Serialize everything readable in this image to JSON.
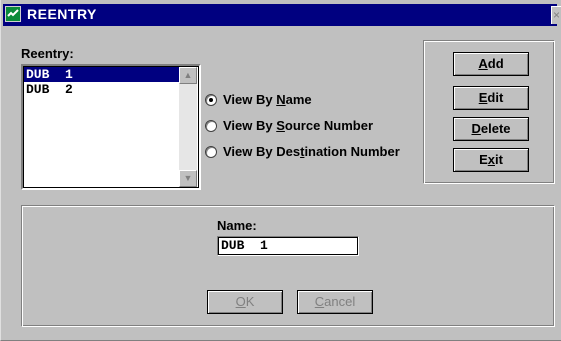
{
  "window": {
    "title": "REENTRY"
  },
  "list": {
    "label": "Reentry:",
    "items": [
      "DUB  1",
      "DUB  2"
    ],
    "selected_index": 0,
    "scroll_up_icon": "arrow-up-icon",
    "scroll_down_icon": "arrow-down-icon"
  },
  "view_options": [
    {
      "prefix": "View By ",
      "key": "N",
      "suffix": "ame",
      "selected": true
    },
    {
      "prefix": "View By ",
      "key": "S",
      "suffix": "ource Number",
      "selected": false
    },
    {
      "prefix": "View By Des",
      "key": "t",
      "suffix": "ination Number",
      "selected": false
    }
  ],
  "actions": {
    "add": {
      "key": "A",
      "rest": "dd"
    },
    "edit": {
      "key": "E",
      "rest": "dit"
    },
    "delete": {
      "key": "D",
      "rest": "elete"
    },
    "exit": {
      "pre": "E",
      "key": "x",
      "rest": "it"
    }
  },
  "detail": {
    "name_label": "Name:",
    "name_value": "DUB  1",
    "ok": {
      "key": "O",
      "rest": "K",
      "enabled": false
    },
    "cancel": {
      "key": "C",
      "rest": "ancel",
      "enabled": false
    }
  },
  "colors": {
    "titlebar": "#000080",
    "face": "#c0c0c0",
    "selection": "#000080",
    "icon": "#0a8a3a"
  }
}
